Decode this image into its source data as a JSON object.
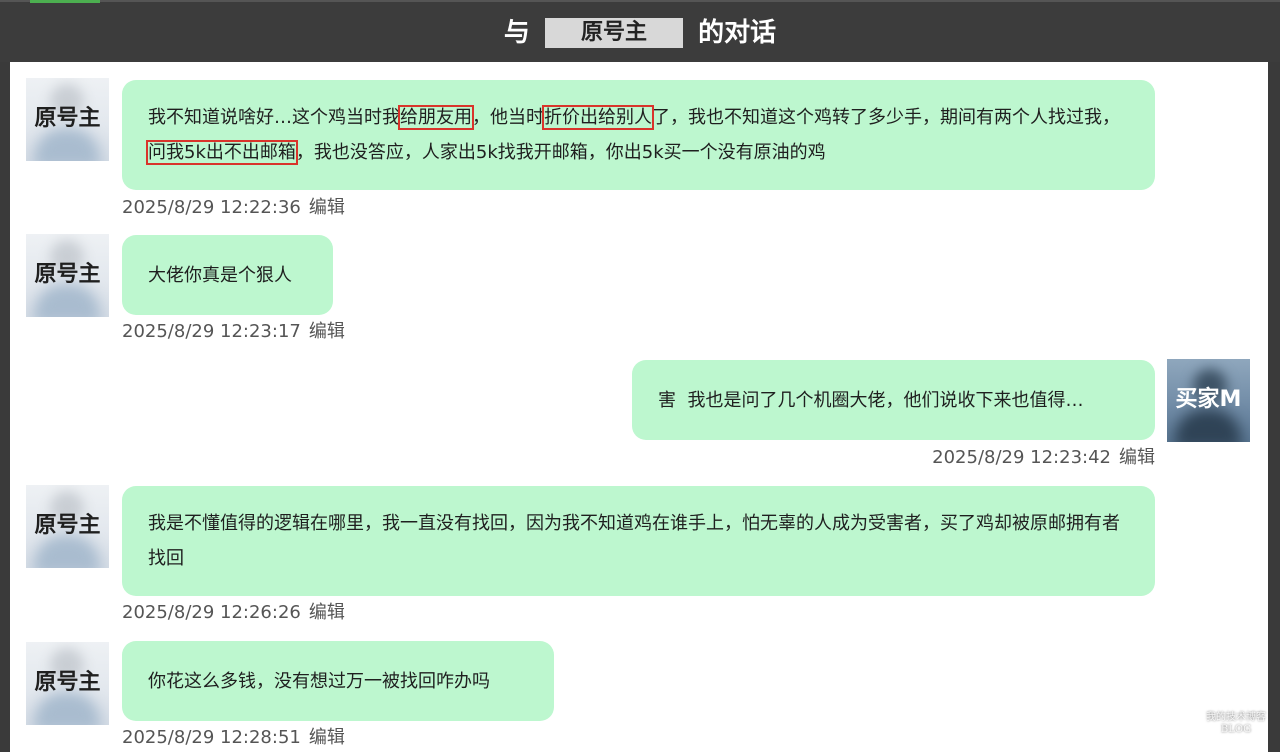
{
  "header": {
    "prefix": "与",
    "contact_name": "原号主",
    "suffix": "的对话"
  },
  "messages": [
    {
      "sender": "原号主",
      "side": "left",
      "segments": [
        {
          "text": "我不知道说啥好…这个鸡当时我",
          "highlight": false
        },
        {
          "text": "给朋友用",
          "highlight": true
        },
        {
          "text": "，他当时",
          "highlight": false
        },
        {
          "text": "折价出给别人",
          "highlight": true
        },
        {
          "text": "了，我也不知道这个鸡转了多少手，期间有两个人找过我，",
          "highlight": false
        },
        {
          "text": "问我5k出不出邮箱",
          "highlight": true
        },
        {
          "text": "，我也没答应，人家出5k找我开邮箱，你出5k买一个没有原油的鸡",
          "highlight": false
        }
      ],
      "timestamp": "2025/8/29 12:22:36",
      "action": "编辑"
    },
    {
      "sender": "原号主",
      "side": "left",
      "segments": [
        {
          "text": "大佬你真是个狠人",
          "highlight": false
        }
      ],
      "timestamp": "2025/8/29 12:23:17",
      "action": "编辑"
    },
    {
      "sender": "买家M",
      "side": "right",
      "segments": [
        {
          "text": "害  我也是问了几个机圈大佬，他们说收下来也值得…",
          "highlight": false
        }
      ],
      "timestamp": "2025/8/29 12:23:42",
      "action": "编辑"
    },
    {
      "sender": "原号主",
      "side": "left",
      "segments": [
        {
          "text": "我是不懂值得的逻辑在哪里，我一直没有找回，因为我不知道鸡在谁手上，怕无辜的人成为受害者，买了鸡却被原邮拥有者找回",
          "highlight": false
        }
      ],
      "timestamp": "2025/8/29 12:26:26",
      "action": "编辑"
    },
    {
      "sender": "原号主",
      "side": "left",
      "segments": [
        {
          "text": "你花这么多钱，没有想过万一被找回咋办吗",
          "highlight": false
        }
      ],
      "timestamp": "2025/8/29 12:28:51",
      "action": "编辑"
    }
  ],
  "watermark": {
    "line1": "我的技术博客",
    "line2": "BLOG"
  }
}
